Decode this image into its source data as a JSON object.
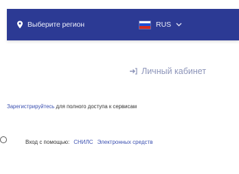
{
  "header": {
    "region_label": "Выберите регион",
    "language_label": "RUS",
    "bg_color": "#2c3a94"
  },
  "cabinet": {
    "label": "Личный кабинет"
  },
  "register": {
    "link_text": "Зарегистрируйтесь",
    "rest_text": " для полного доступа к сервисам"
  },
  "login_with": {
    "label": "Вход с помощью:",
    "options": [
      "СНИЛС",
      "Электронных средств"
    ]
  },
  "icons": [
    "location-pin-icon",
    "russia-flag-icon",
    "chevron-down-icon",
    "login-arrow-icon"
  ]
}
